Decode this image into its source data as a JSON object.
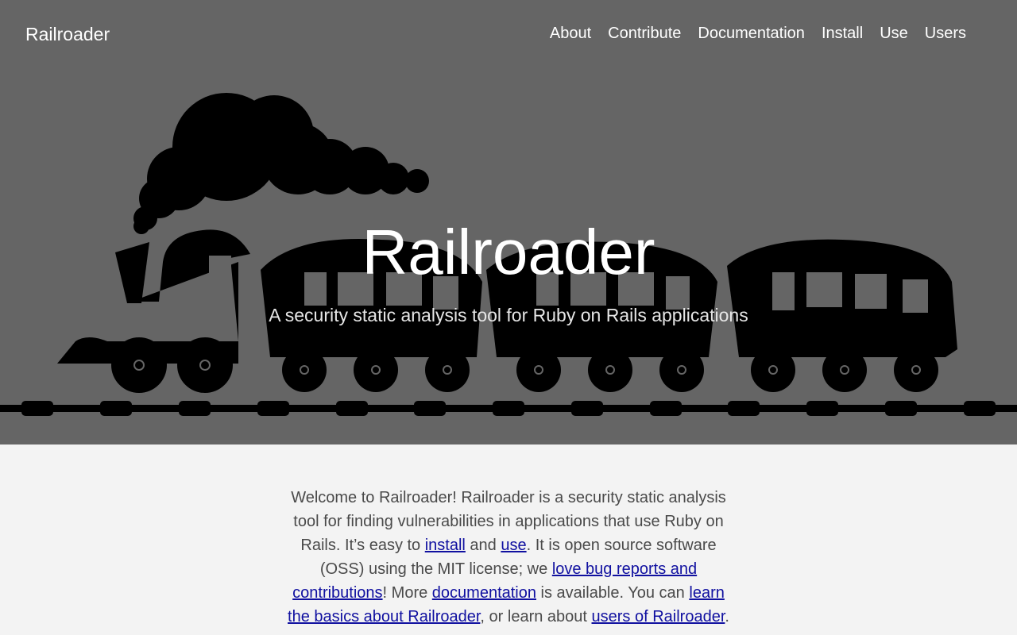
{
  "header": {
    "brand": "Railroader"
  },
  "nav": {
    "items": [
      {
        "label": "About"
      },
      {
        "label": "Contribute"
      },
      {
        "label": "Documentation"
      },
      {
        "label": "Install"
      },
      {
        "label": "Use"
      },
      {
        "label": "Users"
      }
    ]
  },
  "hero": {
    "title": "Railroader",
    "subtitle": "A security static analysis tool for Ruby on Rails applications",
    "illustration": "steam-train-silhouette"
  },
  "intro": {
    "t1": "Welcome to Railroader! Railroader is a security static analysis tool for finding vulnerabilities in applications that use Ruby on Rails. It’s easy to ",
    "link_install": "install",
    "t2": " and ",
    "link_use": "use",
    "t3": ". It is open source software (OSS) using the MIT license; we ",
    "link_contribute": "love bug reports and contributions",
    "t4": "! More ",
    "link_docs": "documentation",
    "t5": " is available. You can ",
    "link_learn": "learn the basics about Railroader",
    "t6": ", or learn about ",
    "link_users": "users of Railroader",
    "t7": "."
  },
  "colors": {
    "hero_bg": "#656565",
    "page_bg": "#f3f3f3",
    "link": "#1010a0",
    "silhouette": "#000000"
  }
}
